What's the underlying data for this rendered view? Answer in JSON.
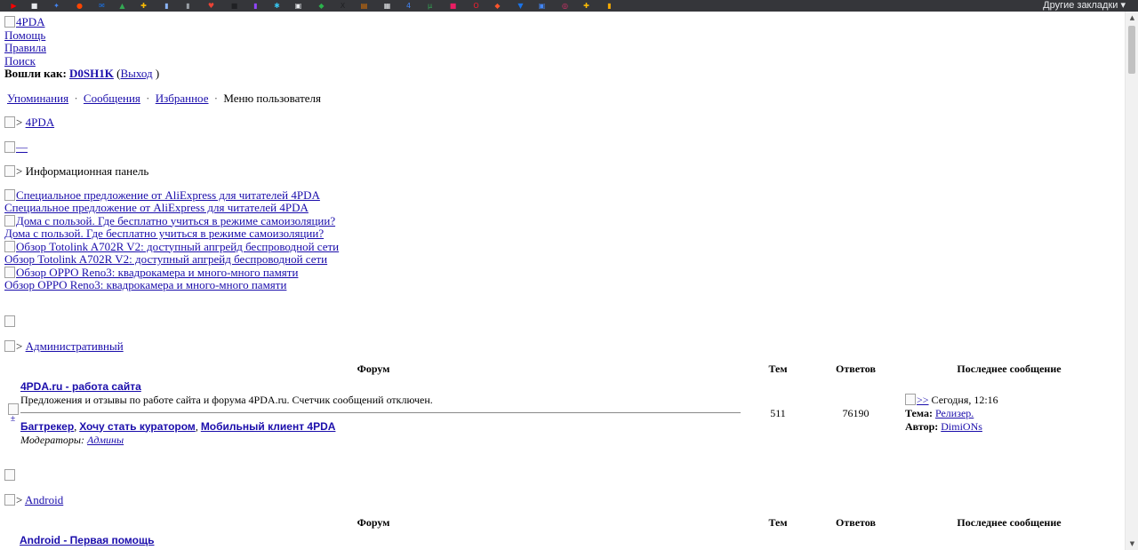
{
  "bookmarks_bar": {
    "icons": [
      {
        "name": "youtube-icon",
        "color": "#ff0000",
        "glyph": "▶"
      },
      {
        "name": "chat-icon",
        "color": "#e8eaed",
        "glyph": "■"
      },
      {
        "name": "gemini-icon",
        "color": "#4285f4",
        "glyph": "✦"
      },
      {
        "name": "reddit-icon",
        "color": "#ff4500",
        "glyph": "●"
      },
      {
        "name": "mail-icon",
        "color": "#1a73e8",
        "glyph": "✉"
      },
      {
        "name": "drive-icon",
        "color": "#34a853",
        "glyph": "▲"
      },
      {
        "name": "pinwheel-icon",
        "color": "#fbbc04",
        "glyph": "✚"
      },
      {
        "name": "doc-icon",
        "color": "#8ab4f8",
        "glyph": "▮"
      },
      {
        "name": "book-icon",
        "color": "#9aa0a6",
        "glyph": "▮"
      },
      {
        "name": "heart-icon",
        "color": "#ea4335",
        "glyph": "♥"
      },
      {
        "name": "tab-icon",
        "color": "#202124",
        "glyph": "■"
      },
      {
        "name": "twitch-icon",
        "color": "#9146ff",
        "glyph": "▮"
      },
      {
        "name": "slack-icon",
        "color": "#36c5f0",
        "glyph": "✱"
      },
      {
        "name": "image-icon",
        "color": "#e8eaed",
        "glyph": "▣"
      },
      {
        "name": "feedly-icon",
        "color": "#2bb24c",
        "glyph": "◆"
      },
      {
        "name": "xda-icon",
        "color": "#202124",
        "glyph": "X"
      },
      {
        "name": "archive-icon",
        "color": "#e37400",
        "glyph": "▤"
      },
      {
        "name": "calendar-icon",
        "color": "#e8eaed",
        "glyph": "▦"
      },
      {
        "name": "four-icon",
        "color": "#4285f4",
        "glyph": "4"
      },
      {
        "name": "torrent-icon",
        "color": "#34a853",
        "glyph": "μ"
      },
      {
        "name": "music-icon",
        "color": "#e91e63",
        "glyph": "■"
      },
      {
        "name": "opera-icon",
        "color": "#ff1b2d",
        "glyph": "O"
      },
      {
        "name": "shield-icon",
        "color": "#fb542b",
        "glyph": "◆"
      },
      {
        "name": "cart-icon",
        "color": "#1a73e8",
        "glyph": "▼"
      },
      {
        "name": "translate-icon",
        "color": "#4285f4",
        "glyph": "▣"
      },
      {
        "name": "instagram-icon",
        "color": "#e1306c",
        "glyph": "◎"
      },
      {
        "name": "pinwheel2-icon",
        "color": "#fbbc04",
        "glyph": "✚"
      },
      {
        "name": "stats-icon",
        "color": "#f9ab00",
        "glyph": "▮"
      }
    ],
    "other_bookmarks": "Другие закладки ▾"
  },
  "header": {
    "logo_alt": "4PDA",
    "links": {
      "help": "Помощь",
      "rules": "Правила",
      "search": "Поиск"
    },
    "logged_in_label": "Вошли как:",
    "username": "D0SH1K",
    "logout_open": "(",
    "logout": "Выход",
    "logout_close": ")"
  },
  "user_menu": {
    "mentions": "Упоминания",
    "messages": "Сообщения",
    "favorites": "Избранное",
    "user_menu": "Меню пользователя",
    "separator": "·"
  },
  "breadcrumb": {
    "arrow": ">",
    "site": "4PDA"
  },
  "collapse_toggle": "—",
  "info_panel": {
    "title": "Информационная панель",
    "news": [
      "Специальное предложение от AliExpress для читателей 4PDA",
      "Дома с пользой. Где бесплатно учиться в режиме самоизоляции?",
      "Обзор Totolink A702R V2: доступный апгрейд беспроводной сети",
      "Обзор OPPO Reno3: квадрокамера и много-много памяти"
    ]
  },
  "categories": [
    {
      "title": "Административный",
      "headers": {
        "forum": "Форум",
        "topics": "Тем",
        "replies": "Ответов",
        "last_post": "Последнее сообщение"
      },
      "forums": [
        {
          "title": "4PDA.ru - работа сайта",
          "description": "Предложения и отзывы по работе сайта и форума 4PDA.ru. Счетчик сообщений отключен.",
          "subforums": [
            "Багтрекер",
            "Хочу стать куратором",
            "Мобильный клиент 4PDA"
          ],
          "moderators_label": "Модераторы:",
          "moderators": "Админы",
          "topics": "511",
          "replies": "76190",
          "last_post": {
            "go_icon_alt": ">>",
            "time": "Сегодня, 12:16",
            "topic_label": "Тема:",
            "topic": "Релизер.",
            "author_label": "Автор:",
            "author": "DimiONs"
          }
        }
      ]
    },
    {
      "title": "Android",
      "headers": {
        "forum": "Форум",
        "topics": "Тем",
        "replies": "Ответов",
        "last_post": "Последнее сообщение"
      },
      "forums": [
        {
          "title": "Android - Первая помощь"
        }
      ]
    }
  ]
}
